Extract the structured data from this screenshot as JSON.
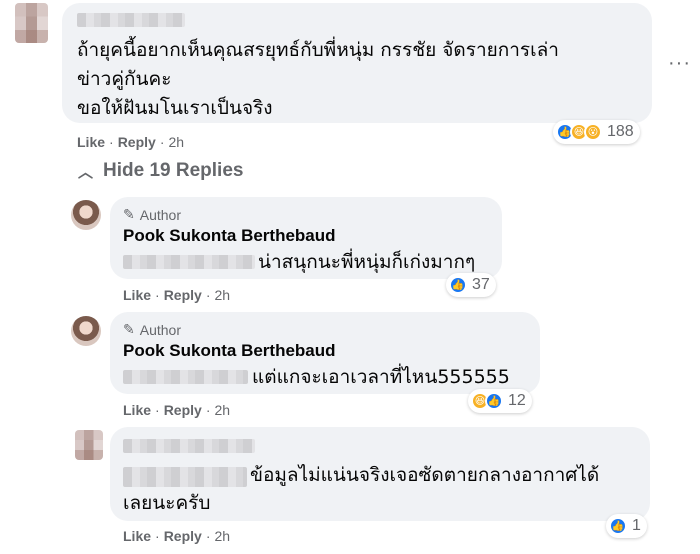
{
  "main_comment": {
    "text_lines": [
      "ถ้ายุคนี้อยากเห็นคุณสรยุทธ์กับพี่หนุ่ม กรรชัย จัดรายการเล่า",
      "ข่าวคู่กันคะ",
      "ขอให้ฝันมโนเราเป็นจริง"
    ],
    "like": "Like",
    "reply": "Reply",
    "time": "2h",
    "reaction_count": "188",
    "reaction_icons": [
      "like-icon",
      "haha-icon",
      "wow-icon"
    ]
  },
  "hide_replies": "Hide 19 Replies",
  "replies": [
    {
      "badge": "Author",
      "name": "Pook Sukonta Berthebaud",
      "text": "น่าสนุกนะพี่หนุ่มก็เก่งมากๆ",
      "like": "Like",
      "reply": "Reply",
      "time": "2h",
      "reaction_count": "37"
    },
    {
      "badge": "Author",
      "name": "Pook Sukonta Berthebaud",
      "text": "แต่แกจะเอาเวลาที่ไหน555555",
      "like": "Like",
      "reply": "Reply",
      "time": "2h",
      "reaction_count": "12"
    },
    {
      "text_lines": [
        "ข้อมูลไม่แน่นจริงเจอซัดตายกลางอากาศได้",
        "เลยนะครับ"
      ],
      "like": "Like",
      "reply": "Reply",
      "time": "2h",
      "reaction_count": "1"
    }
  ],
  "colors": {
    "bubble": "#f0f2f5",
    "secondary_text": "#65676b",
    "like_blue": "#1877f2",
    "haha_yellow": "#f7b125"
  }
}
